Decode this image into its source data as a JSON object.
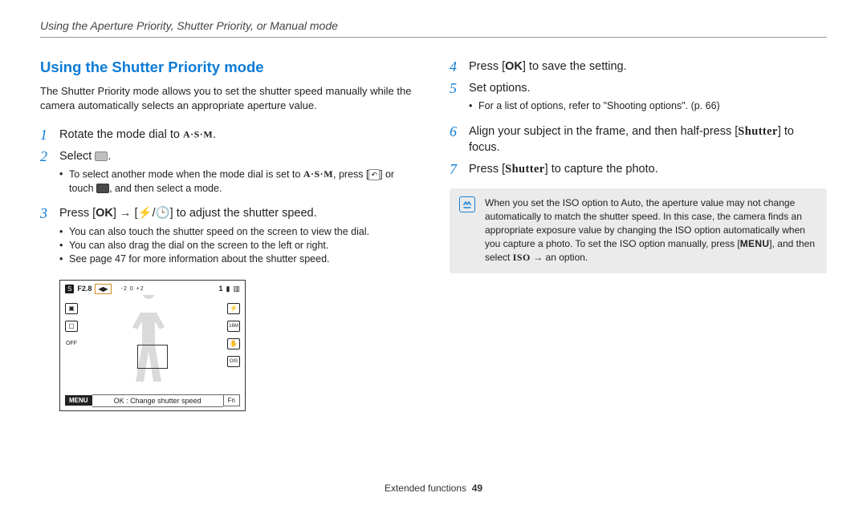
{
  "breadcrumb": "Using the Aperture Priority, Shutter Priority, or Manual mode",
  "section_title": "Using the Shutter Priority mode",
  "intro": "The Shutter Priority mode allows you to set the shutter speed manually while the camera automatically selects an appropriate aperture value.",
  "steps_left": {
    "s1": {
      "num": "1",
      "text_before": "Rotate the mode dial to ",
      "mode_label": "A·S·M",
      "text_after": "."
    },
    "s2": {
      "num": "2",
      "text_before": "Select ",
      "text_after": ".",
      "sub_pre": "To select another mode when the mode dial is set to ",
      "sub_mid1": ", press [",
      "sub_mid2": "] or touch ",
      "sub_end": ", and then select a mode."
    },
    "s3": {
      "num": "3",
      "text_before": "Press [",
      "ok": "OK",
      "mid1": "] → [",
      "mid2": "/",
      "mid3": "] to adjust the shutter speed.",
      "subs": [
        "You can also touch the shutter speed on the screen to view the dial.",
        "You can also drag the dial on the screen to the left or right.",
        "See page 47 for more information about the shutter speed."
      ]
    }
  },
  "steps_right": {
    "s4": {
      "num": "4",
      "pre": "Press [",
      "ok": "OK",
      "post": "] to save the setting."
    },
    "s5": {
      "num": "5",
      "text": "Set options.",
      "subs": [
        "For a list of options, refer to \"Shooting options\". (p. 66)"
      ]
    },
    "s6": {
      "num": "6",
      "pre": "Align your subject in the frame, and then half-press [",
      "shutter": "Shutter",
      "post": "] to focus."
    },
    "s7": {
      "num": "7",
      "pre": "Press [",
      "shutter": "Shutter",
      "post": "] to capture the photo."
    }
  },
  "note": {
    "pre": "When you set the ISO option to Auto, the aperture value may not change automatically to match the shutter speed. In this case, the camera finds an appropriate exposure value by changing the ISO option automatically when you capture a photo. To set the ISO option manually, press [",
    "menu": "MENU",
    "mid": "], and then select ",
    "iso": "ISO",
    "post": " → an option."
  },
  "camera": {
    "fval": "F2.8",
    "scale": "-2   0   +2",
    "count": "1",
    "menu": "MENU",
    "hint": "OK : Change shutter speed",
    "fn": "Fn"
  },
  "footer": {
    "section": "Extended functions",
    "page": "49"
  }
}
